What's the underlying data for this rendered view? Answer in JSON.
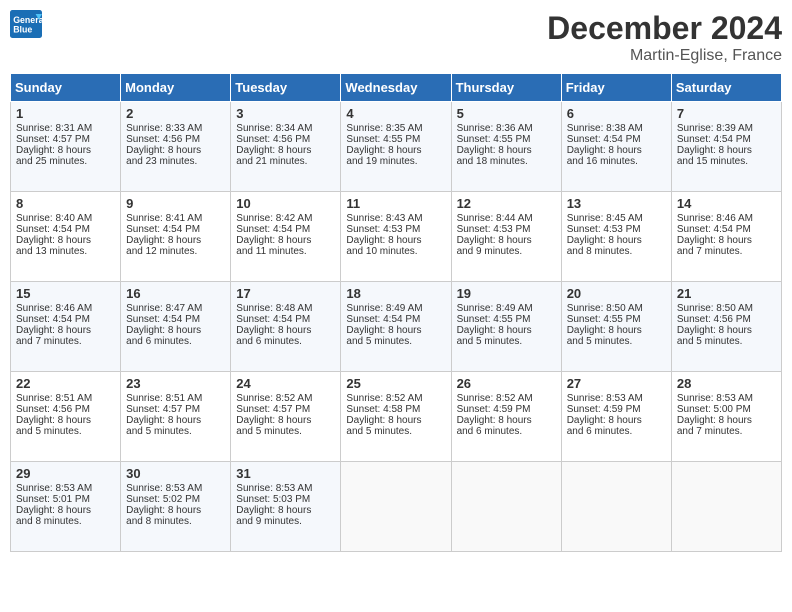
{
  "header": {
    "logo_line1": "General",
    "logo_line2": "Blue",
    "month_year": "December 2024",
    "location": "Martin-Eglise, France"
  },
  "days_of_week": [
    "Sunday",
    "Monday",
    "Tuesday",
    "Wednesday",
    "Thursday",
    "Friday",
    "Saturday"
  ],
  "weeks": [
    [
      {
        "day": "1",
        "info": "Sunrise: 8:31 AM\nSunset: 4:57 PM\nDaylight: 8 hours\nand 25 minutes."
      },
      {
        "day": "2",
        "info": "Sunrise: 8:33 AM\nSunset: 4:56 PM\nDaylight: 8 hours\nand 23 minutes."
      },
      {
        "day": "3",
        "info": "Sunrise: 8:34 AM\nSunset: 4:56 PM\nDaylight: 8 hours\nand 21 minutes."
      },
      {
        "day": "4",
        "info": "Sunrise: 8:35 AM\nSunset: 4:55 PM\nDaylight: 8 hours\nand 19 minutes."
      },
      {
        "day": "5",
        "info": "Sunrise: 8:36 AM\nSunset: 4:55 PM\nDaylight: 8 hours\nand 18 minutes."
      },
      {
        "day": "6",
        "info": "Sunrise: 8:38 AM\nSunset: 4:54 PM\nDaylight: 8 hours\nand 16 minutes."
      },
      {
        "day": "7",
        "info": "Sunrise: 8:39 AM\nSunset: 4:54 PM\nDaylight: 8 hours\nand 15 minutes."
      }
    ],
    [
      {
        "day": "8",
        "info": "Sunrise: 8:40 AM\nSunset: 4:54 PM\nDaylight: 8 hours\nand 13 minutes."
      },
      {
        "day": "9",
        "info": "Sunrise: 8:41 AM\nSunset: 4:54 PM\nDaylight: 8 hours\nand 12 minutes."
      },
      {
        "day": "10",
        "info": "Sunrise: 8:42 AM\nSunset: 4:54 PM\nDaylight: 8 hours\nand 11 minutes."
      },
      {
        "day": "11",
        "info": "Sunrise: 8:43 AM\nSunset: 4:53 PM\nDaylight: 8 hours\nand 10 minutes."
      },
      {
        "day": "12",
        "info": "Sunrise: 8:44 AM\nSunset: 4:53 PM\nDaylight: 8 hours\nand 9 minutes."
      },
      {
        "day": "13",
        "info": "Sunrise: 8:45 AM\nSunset: 4:53 PM\nDaylight: 8 hours\nand 8 minutes."
      },
      {
        "day": "14",
        "info": "Sunrise: 8:46 AM\nSunset: 4:54 PM\nDaylight: 8 hours\nand 7 minutes."
      }
    ],
    [
      {
        "day": "15",
        "info": "Sunrise: 8:46 AM\nSunset: 4:54 PM\nDaylight: 8 hours\nand 7 minutes."
      },
      {
        "day": "16",
        "info": "Sunrise: 8:47 AM\nSunset: 4:54 PM\nDaylight: 8 hours\nand 6 minutes."
      },
      {
        "day": "17",
        "info": "Sunrise: 8:48 AM\nSunset: 4:54 PM\nDaylight: 8 hours\nand 6 minutes."
      },
      {
        "day": "18",
        "info": "Sunrise: 8:49 AM\nSunset: 4:54 PM\nDaylight: 8 hours\nand 5 minutes."
      },
      {
        "day": "19",
        "info": "Sunrise: 8:49 AM\nSunset: 4:55 PM\nDaylight: 8 hours\nand 5 minutes."
      },
      {
        "day": "20",
        "info": "Sunrise: 8:50 AM\nSunset: 4:55 PM\nDaylight: 8 hours\nand 5 minutes."
      },
      {
        "day": "21",
        "info": "Sunrise: 8:50 AM\nSunset: 4:56 PM\nDaylight: 8 hours\nand 5 minutes."
      }
    ],
    [
      {
        "day": "22",
        "info": "Sunrise: 8:51 AM\nSunset: 4:56 PM\nDaylight: 8 hours\nand 5 minutes."
      },
      {
        "day": "23",
        "info": "Sunrise: 8:51 AM\nSunset: 4:57 PM\nDaylight: 8 hours\nand 5 minutes."
      },
      {
        "day": "24",
        "info": "Sunrise: 8:52 AM\nSunset: 4:57 PM\nDaylight: 8 hours\nand 5 minutes."
      },
      {
        "day": "25",
        "info": "Sunrise: 8:52 AM\nSunset: 4:58 PM\nDaylight: 8 hours\nand 5 minutes."
      },
      {
        "day": "26",
        "info": "Sunrise: 8:52 AM\nSunset: 4:59 PM\nDaylight: 8 hours\nand 6 minutes."
      },
      {
        "day": "27",
        "info": "Sunrise: 8:53 AM\nSunset: 4:59 PM\nDaylight: 8 hours\nand 6 minutes."
      },
      {
        "day": "28",
        "info": "Sunrise: 8:53 AM\nSunset: 5:00 PM\nDaylight: 8 hours\nand 7 minutes."
      }
    ],
    [
      {
        "day": "29",
        "info": "Sunrise: 8:53 AM\nSunset: 5:01 PM\nDaylight: 8 hours\nand 8 minutes."
      },
      {
        "day": "30",
        "info": "Sunrise: 8:53 AM\nSunset: 5:02 PM\nDaylight: 8 hours\nand 8 minutes."
      },
      {
        "day": "31",
        "info": "Sunrise: 8:53 AM\nSunset: 5:03 PM\nDaylight: 8 hours\nand 9 minutes."
      },
      {
        "day": "",
        "info": ""
      },
      {
        "day": "",
        "info": ""
      },
      {
        "day": "",
        "info": ""
      },
      {
        "day": "",
        "info": ""
      }
    ]
  ]
}
